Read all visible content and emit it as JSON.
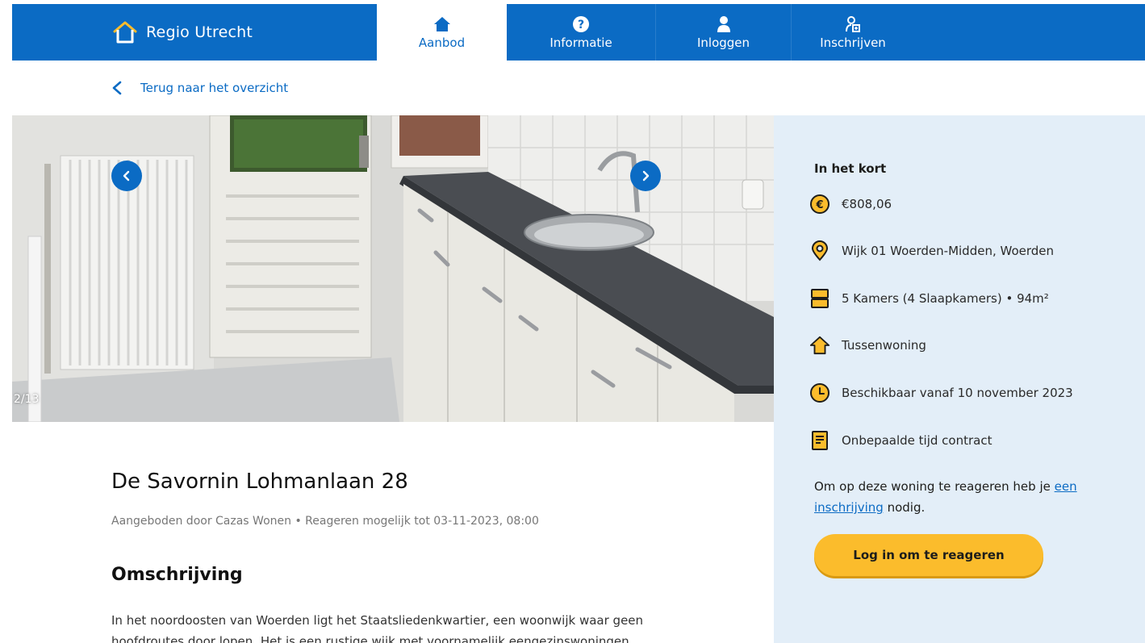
{
  "header": {
    "brand": "Regio Utrecht",
    "nav": [
      {
        "label": "Aanbod",
        "icon": "house-icon"
      },
      {
        "label": "Informatie",
        "icon": "question-icon"
      },
      {
        "label": "Inloggen",
        "icon": "user-icon"
      },
      {
        "label": "Inschrijven",
        "icon": "user-add-icon"
      }
    ]
  },
  "back_link": "Terug naar het overzicht",
  "gallery": {
    "counter": "2/13"
  },
  "summary": {
    "heading": "In het kort",
    "facts": [
      {
        "icon": "euro-icon",
        "text": "€808,06"
      },
      {
        "icon": "location-pin-icon",
        "text": "Wijk 01 Woerden-Midden, Woerden"
      },
      {
        "icon": "rooms-icon",
        "text": "5 Kamers (4 Slaapkamers) • 94m²"
      },
      {
        "icon": "house-type-icon",
        "text": "Tussenwoning"
      },
      {
        "icon": "clock-icon",
        "text": "Beschikbaar vanaf 10 november 2023"
      },
      {
        "icon": "contract-icon",
        "text": "Onbepaalde tijd contract"
      }
    ],
    "note_before": "Om op deze woning te reageren heb je ",
    "note_link": "een inschrijving",
    "note_after": " nodig.",
    "button": "Log in om te reageren"
  },
  "listing": {
    "title": "De Savornin Lohmanlaan 28",
    "meta": "Aangeboden door Cazas Wonen • Reageren mogelijk tot 03-11-2023, 08:00",
    "section_title": "Omschrijving",
    "description": "In het noordoosten van Woerden ligt het Staatsliedenkwartier, een woonwijk waar geen hoofdroutes door lopen. Het is een rustige wijk met voornamelijk eengezinswoningen."
  },
  "colors": {
    "brand_blue": "#0b6bc4",
    "accent_yellow": "#fbbc2c",
    "sidebar_bg": "#e3eef8"
  }
}
